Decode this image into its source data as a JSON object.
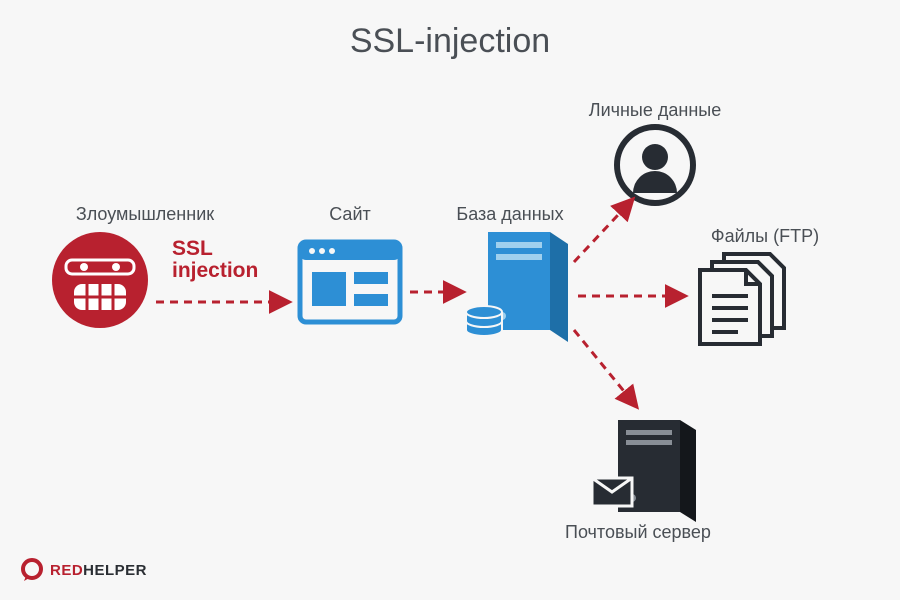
{
  "title": "SSL-injection",
  "nodes": {
    "attacker": "Злоумышленник",
    "site": "Сайт",
    "database": "База данных",
    "personal_data": "Личные данные",
    "files": "Файлы (FTP)",
    "mail_server": "Почтовый сервер"
  },
  "edge_label": {
    "line1": "SSL",
    "line2": "injection"
  },
  "logo": {
    "red": "RED",
    "dark": "HELPER"
  },
  "colors": {
    "red": "#b8212f",
    "blue": "#2d8fd5",
    "dark": "#272c33"
  },
  "chart_data": {
    "type": "flow-diagram",
    "title": "SSL-injection",
    "nodes": [
      {
        "id": "attacker",
        "label": "Злоумышленник",
        "icon": "attacker-face"
      },
      {
        "id": "site",
        "label": "Сайт",
        "icon": "browser-window"
      },
      {
        "id": "database",
        "label": "База данных",
        "icon": "database-server"
      },
      {
        "id": "personal_data",
        "label": "Личные данные",
        "icon": "user-avatar"
      },
      {
        "id": "files",
        "label": "Файлы (FTP)",
        "icon": "document-stack"
      },
      {
        "id": "mail_server",
        "label": "Почтовый сервер",
        "icon": "mail-server"
      }
    ],
    "edges": [
      {
        "from": "attacker",
        "to": "site",
        "label": "SSL injection",
        "style": "dashed",
        "color": "#b8212f"
      },
      {
        "from": "site",
        "to": "database",
        "style": "dashed",
        "color": "#b8212f"
      },
      {
        "from": "database",
        "to": "personal_data",
        "style": "dashed",
        "color": "#b8212f"
      },
      {
        "from": "database",
        "to": "files",
        "style": "dashed",
        "color": "#b8212f"
      },
      {
        "from": "database",
        "to": "mail_server",
        "style": "dashed",
        "color": "#b8212f"
      }
    ]
  }
}
